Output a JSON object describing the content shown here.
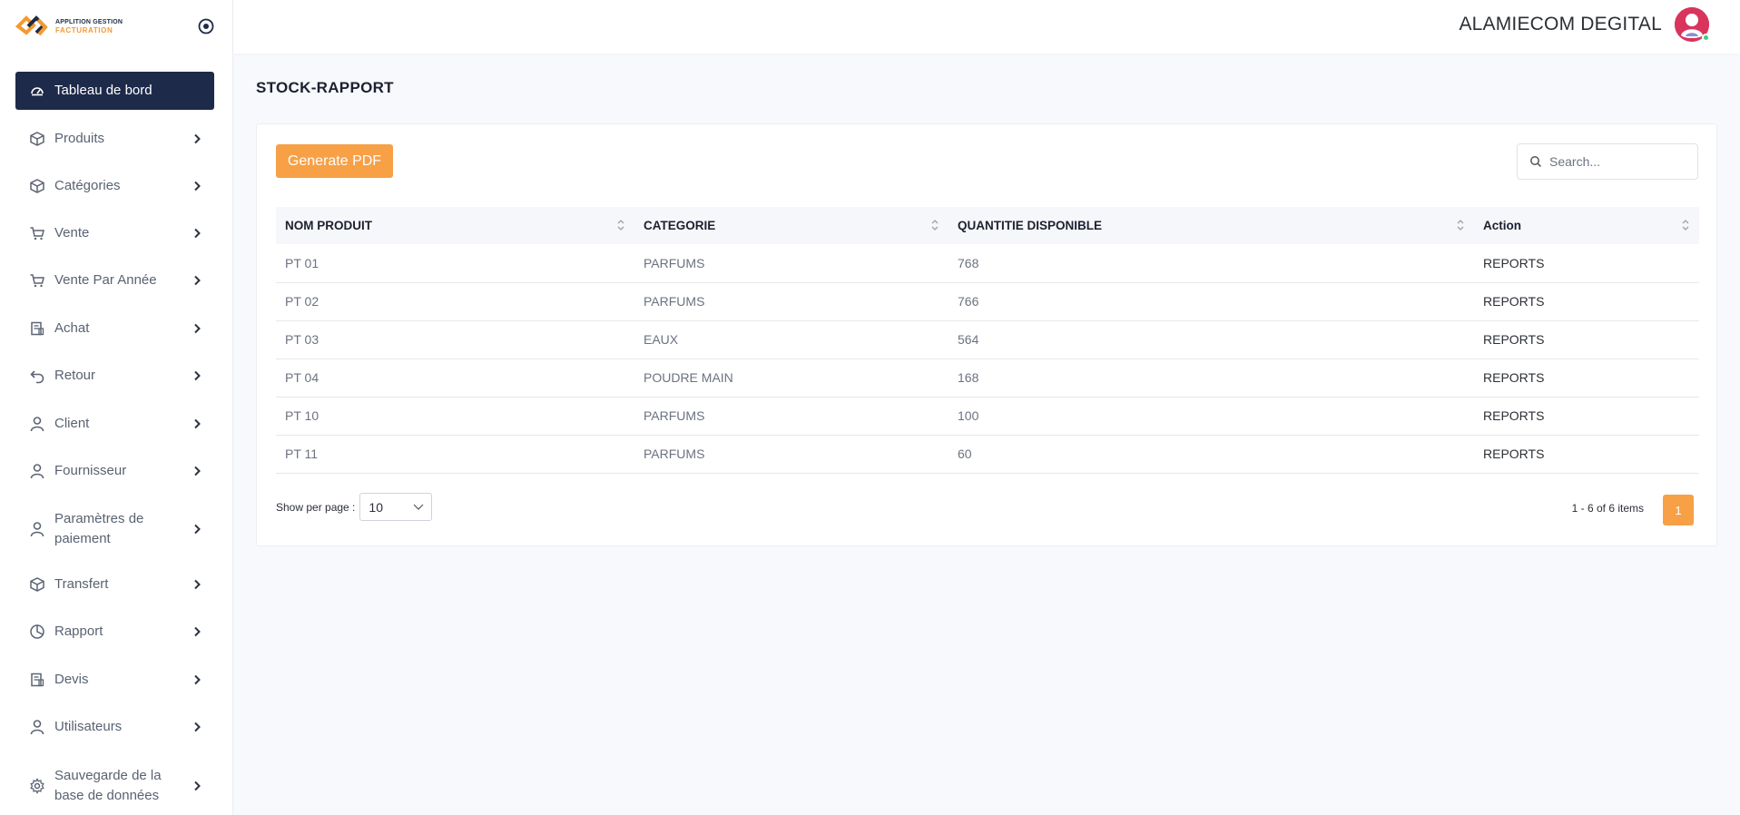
{
  "app": {
    "logo_line1": "APPLITION GESTION",
    "logo_line2": "FACTURATION",
    "brand_orange": "#f7a046",
    "brand_navy": "#1e2a4a"
  },
  "sidebar": {
    "items": [
      {
        "label": "Tableau de bord",
        "icon": "dashboard-icon",
        "active": true
      },
      {
        "label": "Produits",
        "icon": "box-icon"
      },
      {
        "label": "Catégories",
        "icon": "box-icon"
      },
      {
        "label": "Vente",
        "icon": "cart-icon"
      },
      {
        "label": "Vente Par Année",
        "icon": "cart-icon"
      },
      {
        "label": "Achat",
        "icon": "receipt-icon"
      },
      {
        "label": "Retour",
        "icon": "undo-icon"
      },
      {
        "label": "Client",
        "icon": "user-icon"
      },
      {
        "label": "Fournisseur",
        "icon": "user-icon"
      },
      {
        "label": "Paramètres de paiement",
        "icon": "user-icon"
      },
      {
        "label": "Transfert",
        "icon": "box-icon"
      },
      {
        "label": "Rapport",
        "icon": "pie-chart-icon"
      },
      {
        "label": "Devis",
        "icon": "receipt-icon"
      },
      {
        "label": "Utilisateurs",
        "icon": "user-icon"
      },
      {
        "label": "Sauvegarde de la base de données",
        "icon": "gear-icon"
      }
    ]
  },
  "header": {
    "user_name": "ALAMIECOM DEGITAL"
  },
  "page": {
    "title": "STOCK-RAPPORT",
    "generate_pdf_label": "Generate PDF",
    "search_placeholder": "Search..."
  },
  "table": {
    "columns": [
      "NOM PRODUIT",
      "CATEGORIE",
      "QUANTITIE DISPONIBLE",
      "Action"
    ],
    "rows": [
      [
        "PT 01",
        "PARFUMS",
        "768",
        "REPORTS"
      ],
      [
        "PT 02",
        "PARFUMS",
        "766",
        "REPORTS"
      ],
      [
        "PT 03",
        "EAUX",
        "564",
        "REPORTS"
      ],
      [
        "PT 04",
        "POUDRE MAIN",
        "168",
        "REPORTS"
      ],
      [
        "PT 10",
        "PARFUMS",
        "100",
        "REPORTS"
      ],
      [
        "PT 11",
        "PARFUMS",
        "60",
        "REPORTS"
      ]
    ]
  },
  "pagination": {
    "per_page_label": "Show per page :",
    "per_page_value": "10",
    "info": "1 - 6 of 6 items",
    "current_page": "1"
  }
}
